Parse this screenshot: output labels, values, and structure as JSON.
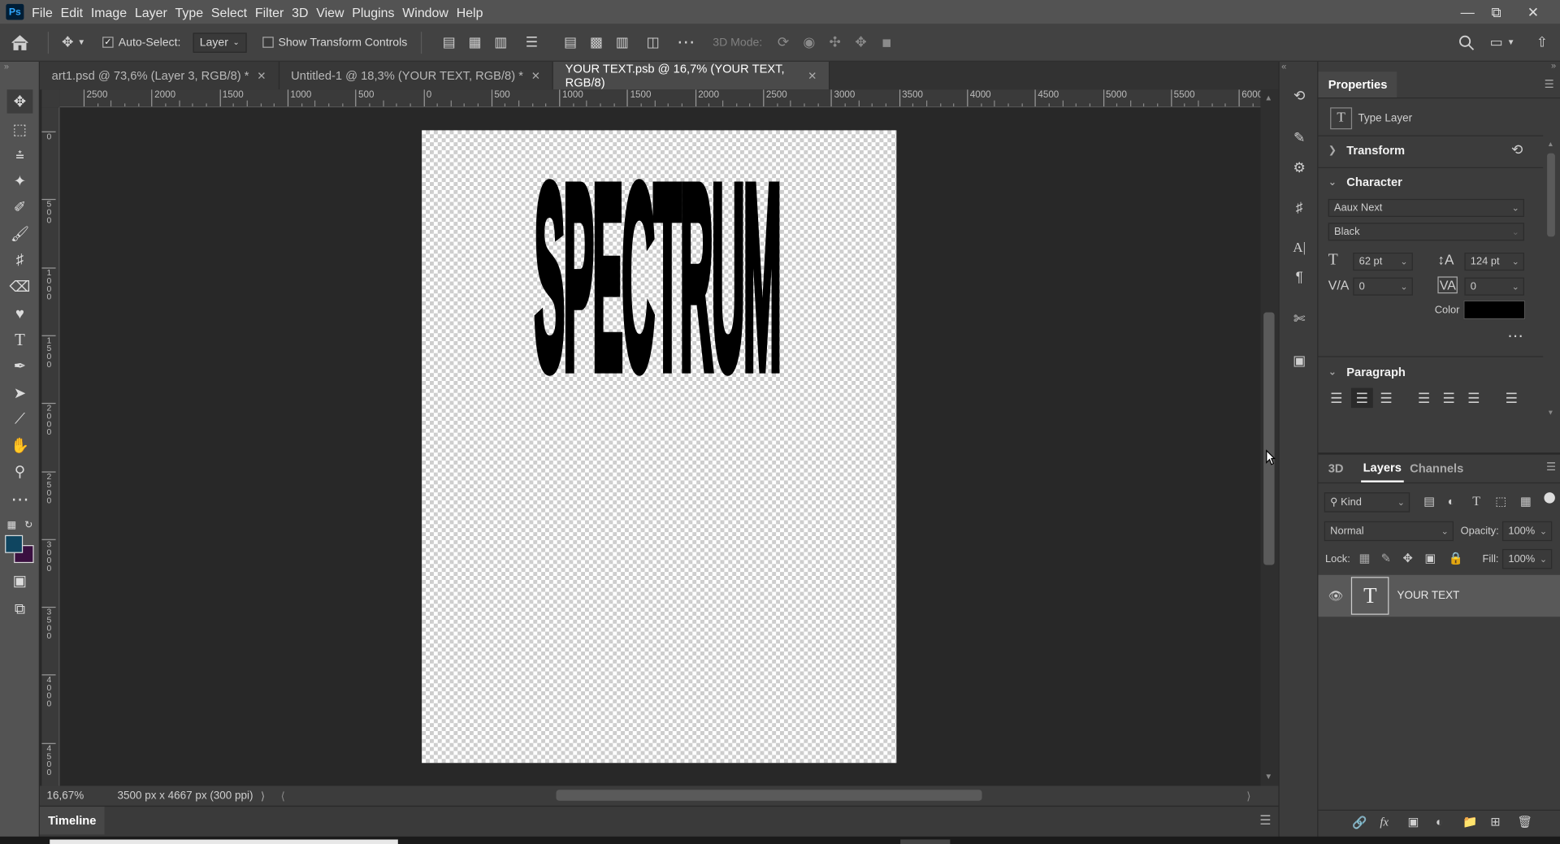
{
  "app": {
    "logo": "Ps"
  },
  "menu": [
    "File",
    "Edit",
    "Image",
    "Layer",
    "Type",
    "Select",
    "Filter",
    "3D",
    "View",
    "Plugins",
    "Window",
    "Help"
  ],
  "options": {
    "auto_select_label": "Auto-Select:",
    "auto_select_value": "Layer",
    "transform_controls_label": "Show Transform Controls",
    "mode_3d_label": "3D Mode:"
  },
  "tabs": [
    {
      "label": "art1.psd @ 73,6% (Layer 3, RGB/8) *"
    },
    {
      "label": "Untitled-1 @ 18,3% (YOUR TEXT, RGB/8) *"
    },
    {
      "label": "YOUR TEXT.psb @ 16,7% (YOUR TEXT, RGB/8)"
    }
  ],
  "ruler_h": [
    "2500",
    "2000",
    "1500",
    "1000",
    "500",
    "0",
    "500",
    "1000",
    "1500",
    "2000",
    "2500",
    "3000",
    "3500",
    "4000",
    "4500",
    "5000",
    "5500",
    "6000"
  ],
  "ruler_v": [
    "0",
    "5 0 0",
    "1 0 0 0",
    "1 5 0 0",
    "2 0 0 0",
    "2 5 0 0",
    "3 0 0 0",
    "3 5 0 0",
    "4 0 0 0",
    "4 5 0 0"
  ],
  "canvas": {
    "text": "SPECTRUM"
  },
  "status": {
    "zoom": "16,67%",
    "doc_size": "3500 px x 4667 px (300 ppi)"
  },
  "timeline": {
    "label": "Timeline"
  },
  "properties": {
    "title": "Properties",
    "layer_kind": "Type Layer",
    "transform": "Transform",
    "character": "Character",
    "font_family": "Aaux Next",
    "font_style": "Black",
    "font_size": "62 pt",
    "leading": "124 pt",
    "kerning": "0",
    "tracking": "0",
    "color_label": "Color",
    "color_value": "#000000",
    "paragraph": "Paragraph"
  },
  "layers_panel": {
    "tabs": [
      "3D",
      "Layers",
      "Channels"
    ],
    "filter_kind": "Kind",
    "blend_mode": "Normal",
    "opacity_label": "Opacity:",
    "opacity": "100%",
    "lock_label": "Lock:",
    "fill_label": "Fill:",
    "fill": "100%",
    "layers": [
      {
        "name": "YOUR TEXT",
        "type": "T"
      }
    ]
  }
}
